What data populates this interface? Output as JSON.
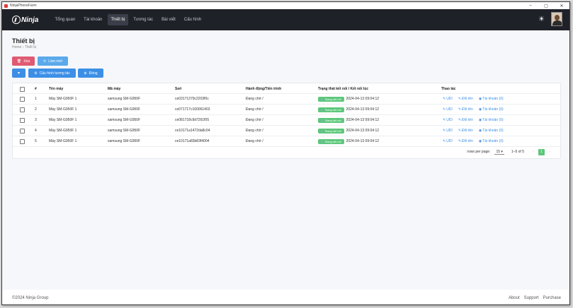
{
  "window": {
    "title": "NinjaPhoneFarm",
    "controls": [
      "–",
      "▢",
      "✕"
    ]
  },
  "brand": {
    "logo_text": "Ninja"
  },
  "nav": {
    "items": [
      "Tổng quan",
      "Tài khoản",
      "Thiết bị",
      "Tương tác",
      "Bài viết",
      "Cấu hình"
    ],
    "active": "Thiết bị"
  },
  "page": {
    "title": "Thiết bị",
    "breadcrumb": [
      "Home",
      "Thiết bị"
    ]
  },
  "toolbar": {
    "delete_label": "Xóa",
    "refresh_label": "Làm mới",
    "config_label": "Cấu hình tương tác",
    "close_label": "Đóng",
    "dropdown_icon": "chevron-down-icon"
  },
  "table": {
    "headers": [
      "#",
      "Tên máy",
      "Mã máy",
      "Seri",
      "Hành động/Tiến trình",
      "Trạng thái kết nối / Kết nối lúc",
      "Thao tác"
    ],
    "rows": [
      {
        "index": "1",
        "name": "Máy SM-G950F 1",
        "model": "samsung SM-G950F",
        "serial": "ce03171379c2203f0c",
        "action": "Đang chờ /",
        "status": "Đang kết nối",
        "time": "2024-04-13 09:04:12",
        "act_uid": "UID",
        "act_rename": "Đổi tên",
        "act_account": "Tài khoản (0)"
      },
      {
        "index": "2",
        "name": "Máy SM-G950F 1",
        "model": "samsung SM-G950F",
        "serial": "ce071717c160061403",
        "action": "Đang chờ /",
        "status": "Đang kết nối",
        "time": "2024-04-13 09:04:12",
        "act_uid": "UID",
        "act_rename": "Đổi tên",
        "act_account": "Tài khoản (0)"
      },
      {
        "index": "3",
        "name": "Máy SM-G950F 1",
        "model": "samsung SM-G950F",
        "serial": "ce081718c9d7261f05",
        "action": "Đang chờ /",
        "status": "Đang kết nối",
        "time": "2024-04-13 09:04:12",
        "act_uid": "UID",
        "act_rename": "Đổi tên",
        "act_account": "Tài khoản (0)"
      },
      {
        "index": "4",
        "name": "Máy SM-G950F 1",
        "model": "samsung SM-G950F",
        "serial": "ce10171a1472da8c04",
        "action": "Đang chờ /",
        "status": "Đang kết nối",
        "time": "2024-04-13 09:04:12",
        "act_uid": "UID",
        "act_rename": "Đổi tên",
        "act_account": "Tài khoản (0)"
      },
      {
        "index": "5",
        "name": "Máy SM-G950F 1",
        "model": "samsung SM-G950F",
        "serial": "ce10171a83b83f4004",
        "action": "Đang chờ /",
        "status": "Đang kết nối",
        "time": "2024-04-13 09:04:12",
        "act_uid": "UID",
        "act_rename": "Đổi tên",
        "act_account": "Tài khoản (0)"
      }
    ]
  },
  "pagination": {
    "rows_label": "rows per page:",
    "rows_value": "15",
    "range": "1–5 of 5",
    "prev": "‹",
    "page": "1",
    "next": "›"
  },
  "footer": {
    "copyright": "©2024 Ninja Group",
    "links": [
      "About",
      "Support",
      "Purchase"
    ]
  },
  "colors": {
    "navbar": "#1f2128",
    "accent": "#3d8fe6",
    "danger": "#e05a72",
    "success": "#5cc77a",
    "refresh": "#5aa9ec"
  }
}
